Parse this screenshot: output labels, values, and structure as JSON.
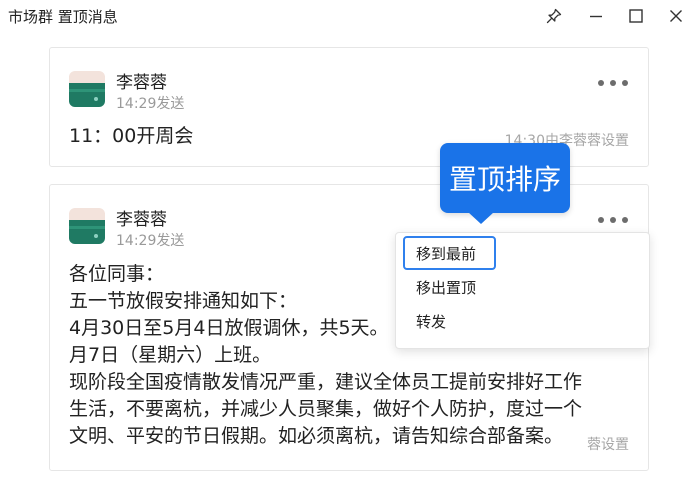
{
  "window": {
    "title": "市场群 置顶消息",
    "controls": [
      "pin-icon",
      "minimize-icon",
      "maximize-icon",
      "close-icon"
    ]
  },
  "messages": [
    {
      "sender": "李蓉蓉",
      "sent_time": "14:29发送",
      "body": "11：00开周会",
      "pin_meta": "14:30由李蓉蓉设置",
      "more_icon": "more-horizontal-icon"
    },
    {
      "sender": "李蓉蓉",
      "sent_time": "14:29发送",
      "body_lines": [
        "各位同事：",
        "五一节放假安排通知如下：",
        "4月30日至5月4日放假调休，共5天。",
        "月7日（星期六）上班。",
        "现阶段全国疫情散发情况严重，建议全体员工提前安排好工作",
        "生活，不要离杭，并减少人员聚集，做好个人防护，度过一个",
        "文明、平安的节日假期。如必须离杭，请告知综合部备案。"
      ],
      "pin_meta": "蓉设置",
      "more_icon": "more-horizontal-icon"
    }
  ],
  "tooltip": {
    "text": "置顶排序",
    "color": "#1a73e8"
  },
  "context_menu": {
    "items": [
      "移到最前",
      "移出置顶",
      "转发"
    ],
    "highlight_color": "#2f80ed"
  }
}
